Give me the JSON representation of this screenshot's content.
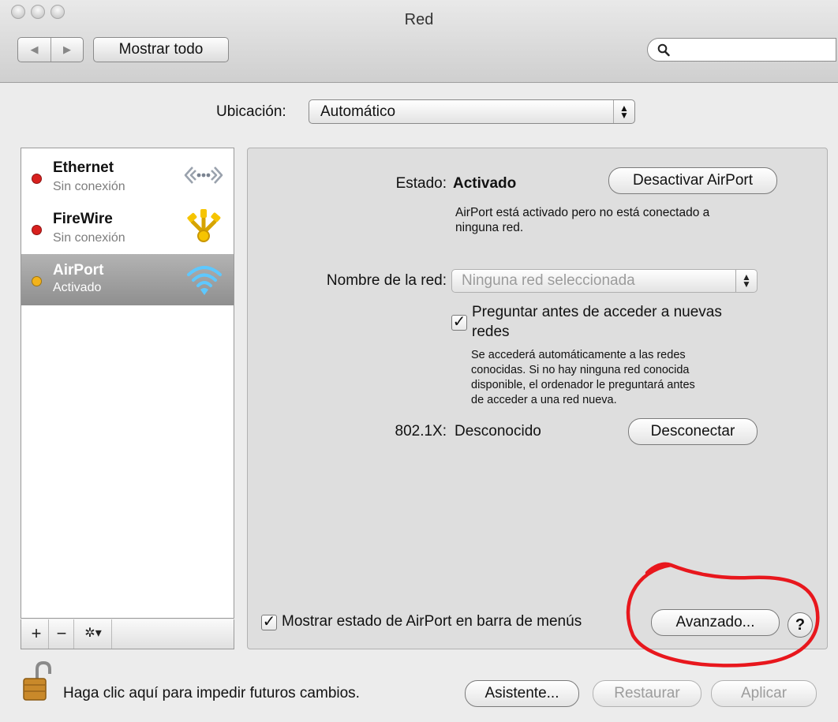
{
  "window": {
    "title": "Red"
  },
  "toolbar": {
    "show_all_label": "Mostrar todo",
    "search_placeholder": "",
    "back_glyph": "◀",
    "forward_glyph": "▶"
  },
  "location": {
    "label": "Ubicación:",
    "value": "Automático"
  },
  "services": [
    {
      "name": "Ethernet",
      "status": "Sin conexión",
      "status_color": "#d8201e",
      "icon": "ethernet-icon"
    },
    {
      "name": "FireWire",
      "status": "Sin conexión",
      "status_color": "#d8201e",
      "icon": "firewire-icon"
    },
    {
      "name": "AirPort",
      "status": "Activado",
      "status_color": "#f3b31b",
      "icon": "wifi-icon",
      "selected": true
    }
  ],
  "sidebar_buttons": {
    "add": "+",
    "remove": "−",
    "gear": "✲▾"
  },
  "detail": {
    "status_label": "Estado:",
    "status_value": "Activado",
    "toggle_button": "Desactivar AirPort",
    "status_desc_1": "AirPort está activado pero no está conectado a",
    "status_desc_2": "ninguna red.",
    "network_label": "Nombre de la red:",
    "network_value": "Ninguna red seleccionada",
    "ask_label_1": "Preguntar antes de acceder a nuevas",
    "ask_label_2": "redes",
    "ask_checked": true,
    "ask_help_1": "Se accederá automáticamente a las redes",
    "ask_help_2": "conocidas. Si no hay ninguna red conocida",
    "ask_help_3": "disponible, el ordenador le preguntará antes",
    "ask_help_4": "de acceder a una red nueva.",
    "dot1x_label": "802.1X:",
    "dot1x_value": "Desconocido",
    "disconnect_button": "Desconectar",
    "show_menu_label": "Mostrar estado de AirPort en barra de menús",
    "show_menu_checked": true,
    "advanced_button": "Avanzado...",
    "help_button": "?"
  },
  "footer": {
    "lock_text": "Haga clic aquí para impedir futuros cambios.",
    "assistant_button": "Asistente...",
    "revert_button": "Restaurar",
    "apply_button": "Aplicar"
  },
  "colors": {
    "annotation": "#e8171d",
    "selection": "#9d9d9d"
  }
}
